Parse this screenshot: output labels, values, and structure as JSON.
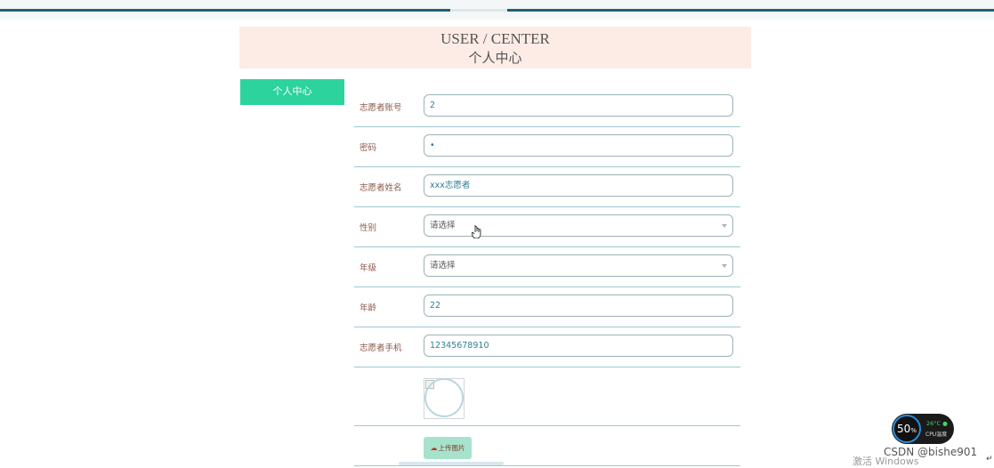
{
  "header": {
    "title_en": "USER / CENTER",
    "title_zh": "个人中心"
  },
  "sidebar": {
    "items": [
      {
        "label": "个人中心"
      }
    ]
  },
  "form": {
    "fields": [
      {
        "label": "志愿者账号",
        "value": "2"
      },
      {
        "label": "密码",
        "value": "•"
      },
      {
        "label": "志愿者姓名",
        "value": "xxx志愿者"
      },
      {
        "label": "性别",
        "value": "请选择"
      },
      {
        "label": "年级",
        "value": "请选择"
      },
      {
        "label": "年龄",
        "value": "22"
      },
      {
        "label": "志愿者手机",
        "value": "12345678910"
      }
    ],
    "upload_label": "上传图片"
  },
  "system": {
    "cpu_percent": "50",
    "cpu_percent_unit": "%",
    "cpu_temp": "26°C",
    "cpu_label": "CPU温度",
    "activate_text": "激活 Windows",
    "watermark": "CSDN @bishe901"
  },
  "colors": {
    "accent": "#2cd39c",
    "header_bg": "#fdece6",
    "topbar": "#1f5f78"
  }
}
